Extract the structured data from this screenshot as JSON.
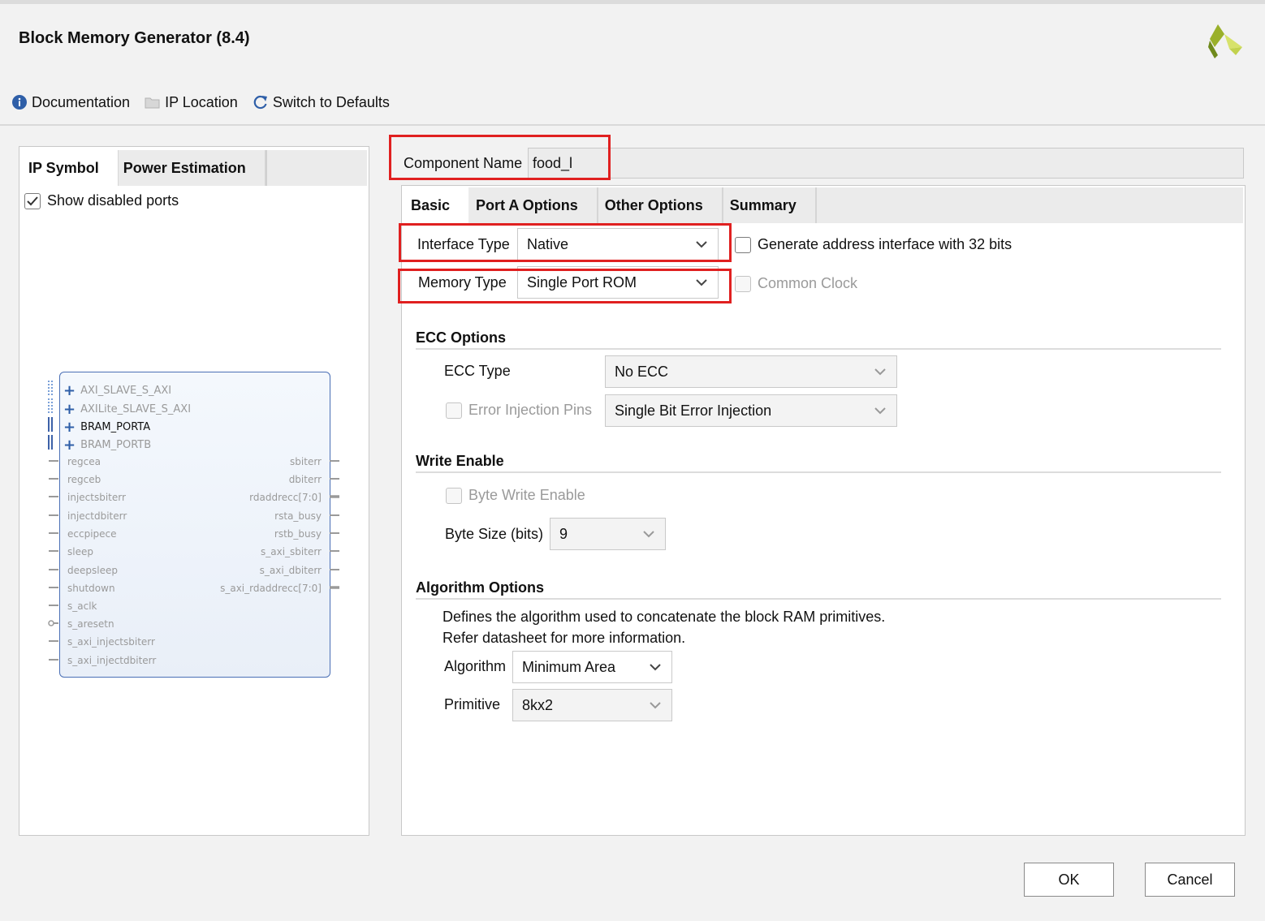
{
  "window": {
    "title": "Block Memory Generator (8.4)"
  },
  "toolbar": {
    "documentation": "Documentation",
    "ip_location": "IP Location",
    "switch_defaults": "Switch to Defaults"
  },
  "left": {
    "tabs": [
      "IP Symbol",
      "Power Estimation"
    ],
    "show_disabled_ports": "Show disabled ports",
    "symbol": {
      "buses": [
        "AXI_SLAVE_S_AXI",
        "AXILite_SLAVE_S_AXI",
        "BRAM_PORTA",
        "BRAM_PORTB"
      ],
      "left_ports": [
        "regcea",
        "regceb",
        "injectsbiterr",
        "injectdbiterr",
        "eccpipece",
        "sleep",
        "deepsleep",
        "shutdown",
        "s_aclk",
        "s_aresetn",
        "s_axi_injectsbiterr",
        "s_axi_injectdbiterr"
      ],
      "right_ports": [
        "sbiterr",
        "dbiterr",
        "rdaddrecc[7:0]",
        "rsta_busy",
        "rstb_busy",
        "s_axi_sbiterr",
        "s_axi_dbiterr",
        "s_axi_rdaddrecc[7:0]"
      ]
    }
  },
  "component": {
    "label": "Component Name",
    "value": "food_l"
  },
  "tabs": [
    "Basic",
    "Port A Options",
    "Other Options",
    "Summary"
  ],
  "basic": {
    "interface_type_label": "Interface Type",
    "interface_type_value": "Native",
    "gen_addr_label": "Generate address interface with 32 bits",
    "memory_type_label": "Memory Type",
    "memory_type_value": "Single Port ROM",
    "common_clock_label": "Common Clock",
    "ecc_section": "ECC Options",
    "ecc_type_label": "ECC Type",
    "ecc_type_value": "No ECC",
    "error_injection_label": "Error Injection Pins",
    "error_injection_value": "Single Bit Error Injection",
    "write_enable_section": "Write Enable",
    "byte_write_enable_label": "Byte Write Enable",
    "byte_size_label": "Byte Size (bits)",
    "byte_size_value": "9",
    "algorithm_section": "Algorithm Options",
    "algorithm_desc_1": "Defines the algorithm used to concatenate the block RAM primitives.",
    "algorithm_desc_2": "Refer datasheet for more information.",
    "algorithm_label": "Algorithm",
    "algorithm_value": "Minimum Area",
    "primitive_label": "Primitive",
    "primitive_value": "8kx2"
  },
  "buttons": {
    "ok": "OK",
    "cancel": "Cancel"
  },
  "colors": {
    "highlight": "#e02020",
    "symbol_border": "#4a6fb5",
    "info_icon": "#2f5fa8",
    "logo": "#9ab02a"
  }
}
